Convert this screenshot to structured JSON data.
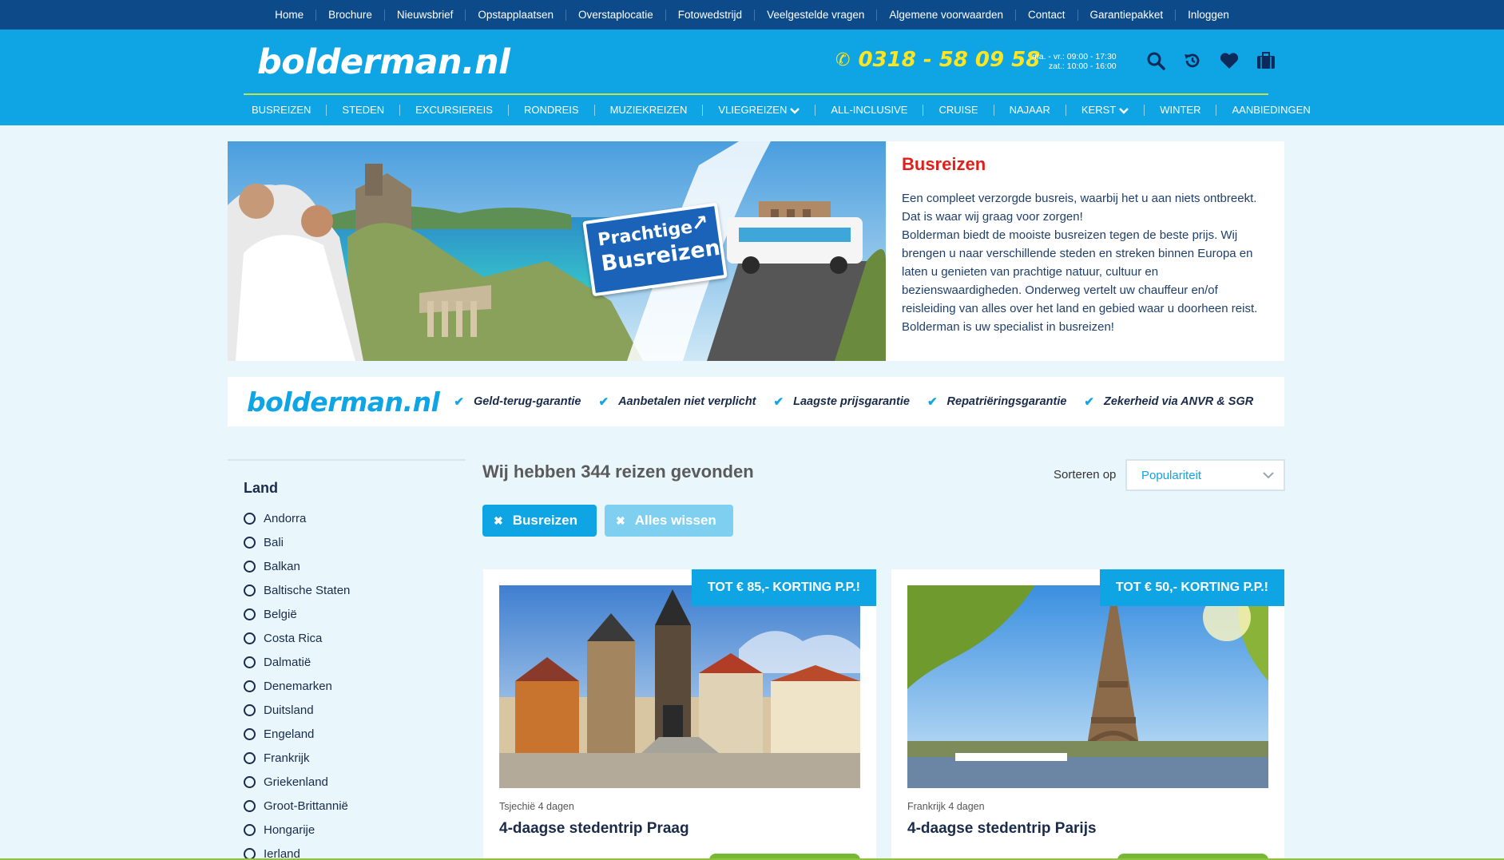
{
  "top_nav": [
    "Home",
    "Brochure",
    "Nieuwsbrief",
    "Opstapplaatsen",
    "Overstaplocatie",
    "Fotowedstrijd",
    "Veelgestelde vragen",
    "Algemene voorwaarden",
    "Contact",
    "Garantiepakket",
    "Inloggen"
  ],
  "header": {
    "logo": "bolderman.nl",
    "phone": "0318 - 58 09 58",
    "hours_line1": "ma. - vr.: 09:00 - 17:30",
    "hours_line2": "zat.: 10:00 - 16:00",
    "icons": [
      "search-icon",
      "history-icon",
      "heart-icon",
      "suitcase-icon"
    ]
  },
  "main_nav": [
    {
      "label": "BUSREIZEN",
      "dropdown": false
    },
    {
      "label": "STEDEN",
      "dropdown": false
    },
    {
      "label": "EXCURSIEREIS",
      "dropdown": false
    },
    {
      "label": "RONDREIS",
      "dropdown": false
    },
    {
      "label": "MUZIEKREIZEN",
      "dropdown": false
    },
    {
      "label": "VLIEGREIZEN",
      "dropdown": true
    },
    {
      "label": "ALL-INCLUSIVE",
      "dropdown": false
    },
    {
      "label": "CRUISE",
      "dropdown": false
    },
    {
      "label": "NAJAAR",
      "dropdown": false
    },
    {
      "label": "KERST",
      "dropdown": true
    },
    {
      "label": "WINTER",
      "dropdown": false
    },
    {
      "label": "AANBIEDINGEN",
      "dropdown": false
    }
  ],
  "hero": {
    "sign_line1": "Prachtige",
    "sign_line2": "Busreizen",
    "title": "Busreizen",
    "paragraph1": "Een compleet verzorgde busreis, waarbij het u aan niets ontbreekt. Dat is waar wij graag voor zorgen!",
    "paragraph2": "Bolderman biedt de mooiste busreizen tegen de beste prijs. Wij brengen u naar verschillende steden en streken binnen Europa en laten u genieten van prachtige natuur, cultuur en bezienswaardigheden. Onderweg vertelt uw chauffeur en/of reisleiding van alles over het land en gebied waar u doorheen reist. Bolderman is uw specialist in busreizen!"
  },
  "usp": {
    "logo": "bolderman.nl",
    "items": [
      "Geld-terug-garantie",
      "Aanbetalen niet verplicht",
      "Laagste prijsgarantie",
      "Repatriëringsgarantie",
      "Zekerheid via ANVR & SGR"
    ]
  },
  "sidebar": {
    "heading": "Land",
    "countries": [
      "Andorra",
      "Bali",
      "Balkan",
      "Baltische Staten",
      "België",
      "Costa Rica",
      "Dalmatië",
      "Denemarken",
      "Duitsland",
      "Engeland",
      "Frankrijk",
      "Griekenland",
      "Groot-Brittannië",
      "Hongarije",
      "Ierland"
    ]
  },
  "results": {
    "title": "Wij hebben 344 reizen gevonden",
    "sort_label": "Sorteren op",
    "sort_value": "Populariteit",
    "chips": [
      "Busreizen",
      "Alles wissen"
    ]
  },
  "cards": [
    {
      "badge": "TOT € 85,- KORTING P.P.!",
      "meta": "Tsjechië 4 dagen",
      "title": "4-daagse stedentrip Praag"
    },
    {
      "badge": "TOT € 50,- KORTING P.P.!",
      "meta": "Frankrijk 4 dagen",
      "title": "4-daagse stedentrip Parijs"
    }
  ],
  "colors": {
    "top_bar": "#0c4a8a",
    "header_blue": "#0fa4e4",
    "phone_yellow": "#ffe51f",
    "hero_title_red": "#e0201b",
    "cta_green": "#75b834",
    "page_bg": "#e9f6fc"
  }
}
